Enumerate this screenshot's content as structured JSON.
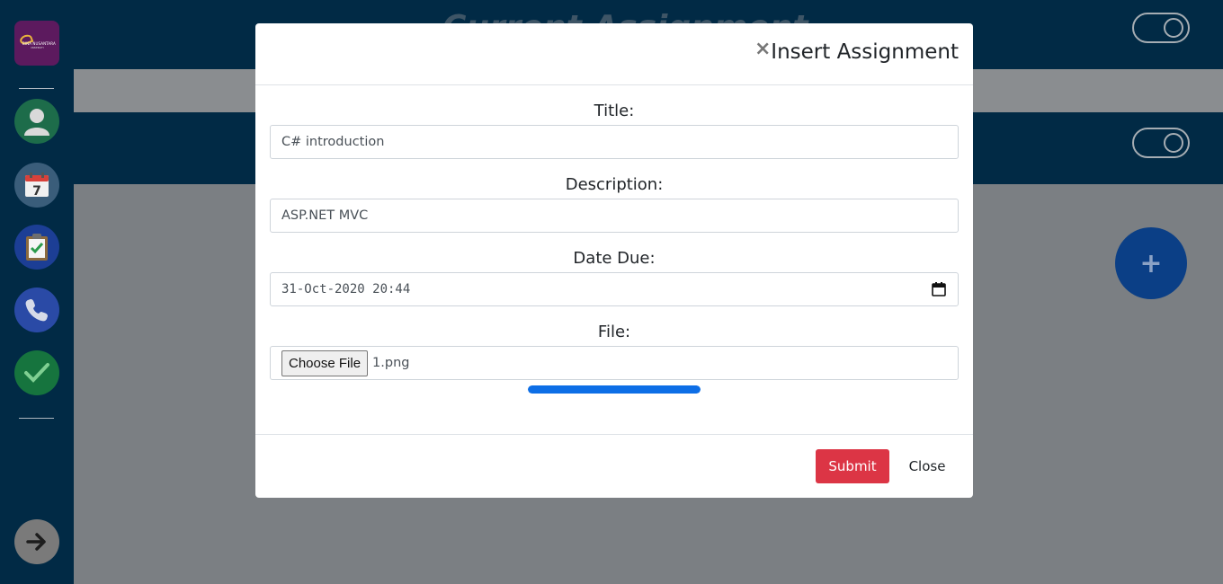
{
  "sidebar": {
    "logo_text": "BINA NUSANTARA",
    "logo_subtext": "UNIVERSITY",
    "items": [
      {
        "name": "profile",
        "icon": "user-icon"
      },
      {
        "name": "schedule",
        "icon": "calendar-icon",
        "label": "7"
      },
      {
        "name": "assignment",
        "icon": "clipboard-check-icon"
      },
      {
        "name": "contact",
        "icon": "phone-icon"
      },
      {
        "name": "done",
        "icon": "checkmark-icon"
      }
    ],
    "logout_icon": "arrow-right-icon"
  },
  "background": {
    "page_title": "Current Assignment",
    "fab_label": "+"
  },
  "modal": {
    "title": "Insert Assignment",
    "close_symbol": "×",
    "fields": {
      "title": {
        "label": "Title:",
        "value": "C# introduction"
      },
      "description": {
        "label": "Description:",
        "value": "ASP.NET MVC"
      },
      "date_due": {
        "label": "Date Due:",
        "value": "31-Oct-2020 20:44"
      },
      "file": {
        "label": "File:",
        "button": "Choose File",
        "value": "1.png"
      }
    },
    "upload_progress": 1.0,
    "buttons": {
      "submit": "Submit",
      "close": "Close"
    }
  },
  "colors": {
    "sidebar": "#012a45",
    "overlay": "#7b7f83",
    "submit": "#dc3545",
    "progress": "#0d6ee6"
  }
}
